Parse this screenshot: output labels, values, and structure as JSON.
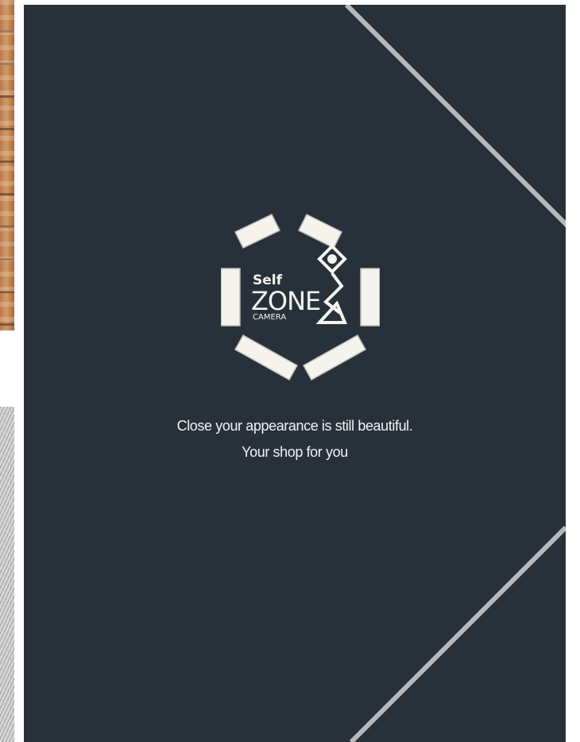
{
  "brand": {
    "logo_line_1": "Self",
    "logo_line_2": "ZONE",
    "logo_line_3": "CAMERA",
    "logo_icon": "camera-aperture-icon"
  },
  "tagline": {
    "line_1": "Close your appearance is still beautiful.",
    "line_2": "Your shop for you"
  },
  "colors": {
    "card_background": "#283139",
    "accent_line": "#b8b8b8",
    "logo_fill": "#f4f3ee",
    "text": "#f2f2f2"
  }
}
